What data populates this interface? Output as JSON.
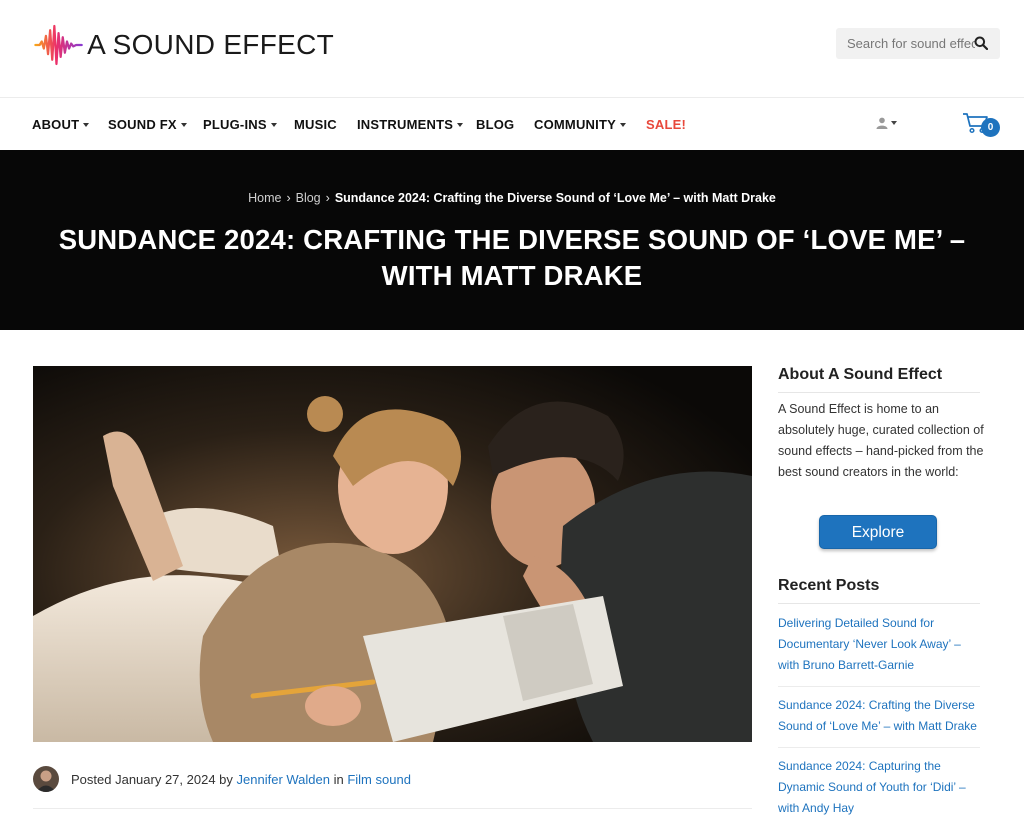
{
  "header": {
    "logo_text": "A SOUND EFFECT",
    "search_placeholder": "Search for sound effects"
  },
  "nav": {
    "items": [
      {
        "label": "ABOUT",
        "has_dropdown": true
      },
      {
        "label": "SOUND FX",
        "has_dropdown": true
      },
      {
        "label": "PLUG-INS",
        "has_dropdown": true
      },
      {
        "label": "MUSIC",
        "has_dropdown": false
      },
      {
        "label": "INSTRUMENTS",
        "has_dropdown": true
      },
      {
        "label": "BLOG",
        "has_dropdown": false
      },
      {
        "label": "COMMUNITY",
        "has_dropdown": true
      },
      {
        "label": "SALE!",
        "has_dropdown": false
      }
    ],
    "cart_count": "0",
    "sale_color": "#e8483b"
  },
  "hero": {
    "breadcrumb": [
      "Home",
      "Blog",
      "Sundance 2024: Crafting the Diverse Sound of ‘Love Me’ – with Matt Drake"
    ],
    "title": "SUNDANCE 2024: CRAFTING THE DIVERSE SOUND OF ‘LOVE ME’ – WITH MATT DRAKE"
  },
  "post": {
    "posted_prefix": "Posted ",
    "date": "January 27, 2024",
    "by": " by ",
    "author": "Jennifer Walden",
    "in": " in ",
    "category": "Film sound"
  },
  "sidebar": {
    "about_title": "About A Sound Effect",
    "about_text": "A Sound Effect is home to an absolutely huge, curated collection of sound effects – hand-picked from the best sound creators in the world:",
    "explore_label": "Explore",
    "recent_title": "Recent Posts",
    "recent_posts": [
      "Delivering Detailed Sound for Documentary ‘Never Look Away’ – with Bruno Barrett-Garnie",
      "Sundance 2024: Crafting the Diverse Sound of ‘Love Me’ – with Matt Drake",
      "Sundance 2024: Capturing the Dynamic Sound of Youth for ‘Didi’ – with Andy Hay"
    ]
  },
  "colors": {
    "accent": "#1e73be",
    "hero_bg": "#070707"
  },
  "icons": {
    "search": "search-icon",
    "user": "user-icon",
    "cart": "cart-icon",
    "logo": "waveform-logo-icon"
  }
}
